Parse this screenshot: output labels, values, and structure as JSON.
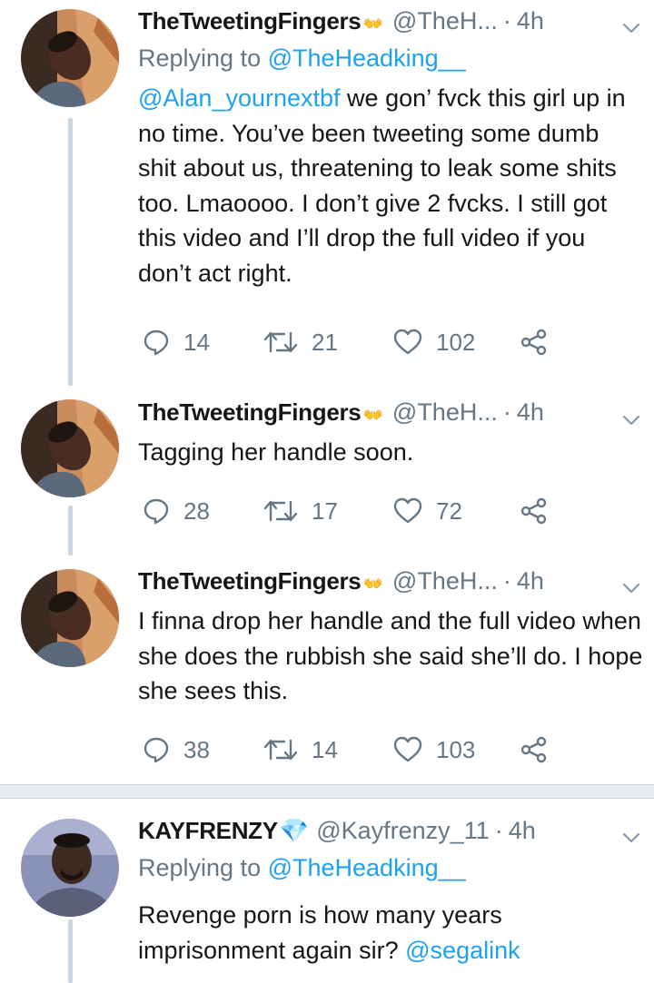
{
  "tweets": [
    {
      "name": "TheTweetingFingers",
      "badge": "👐",
      "handle": "@TheH...",
      "time": "4h",
      "replying_prefix": "Replying to ",
      "replying_to": "@TheHeadking__",
      "text_link": "@Alan_yournextbf",
      "text": " we gon’ fvck this girl up in no time. You’ve been tweeting some dumb shit about us, threatening to leak some shits too.  Lmaoooo. I don’t give 2 fvcks. I still got this video and I’ll drop the full video if you don’t act right.",
      "replies": "14",
      "retweets": "21",
      "likes": "102"
    },
    {
      "name": "TheTweetingFingers",
      "badge": "👐",
      "handle": "@TheH...",
      "time": "4h",
      "text": "Tagging her handle soon.",
      "replies": "28",
      "retweets": "17",
      "likes": "72"
    },
    {
      "name": "TheTweetingFingers",
      "badge": "👐",
      "handle": "@TheH...",
      "time": "4h",
      "text": "I finna drop her handle and the full video when she does the rubbish she said she’ll do. I hope she sees this.",
      "replies": "38",
      "retweets": "14",
      "likes": "103"
    },
    {
      "name": "KAYFRENZY",
      "badge": "💎",
      "handle": "@Kayfrenzy_11",
      "time": "4h",
      "replying_prefix": "Replying to ",
      "replying_to": "@TheHeadking__",
      "text": "Revenge porn is how many years imprisonment again sir? ",
      "text_link_end": "@segalink"
    }
  ],
  "colors": {
    "link": "#1da1f2",
    "secondary": "#657786",
    "primary": "#14171a",
    "thread_line": "#ccd6dd",
    "divider": "#e6ecf0"
  },
  "icons": {
    "reply": "reply-icon",
    "retweet": "retweet-icon",
    "like": "heart-icon",
    "share": "share-icon",
    "menu": "chevron-down-icon"
  }
}
